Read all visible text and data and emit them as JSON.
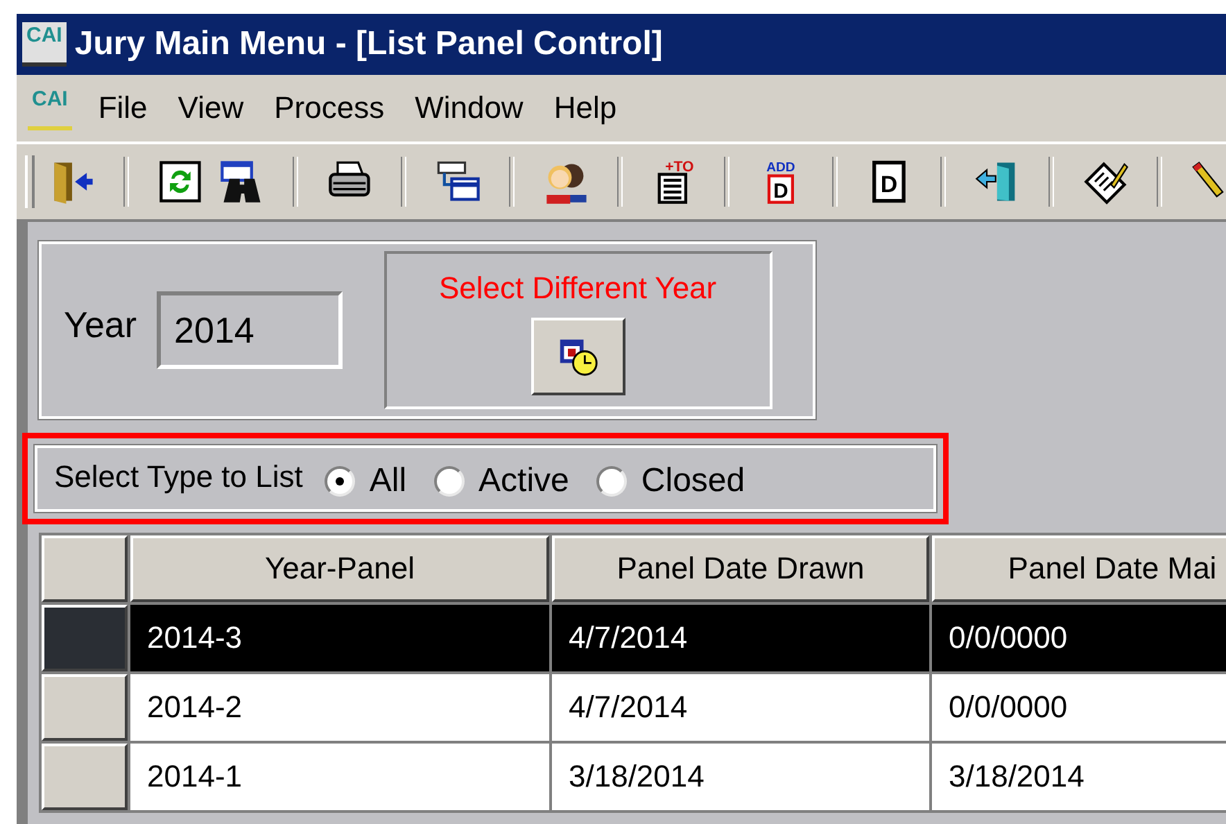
{
  "window": {
    "logo": "CAI",
    "title": "Jury Main Menu - [List Panel Control]"
  },
  "menu": {
    "logo": "CAI",
    "items": [
      "File",
      "View",
      "Process",
      "Window",
      "Help"
    ]
  },
  "toolbar": [
    [
      {
        "kind": "exit"
      }
    ],
    [
      {
        "kind": "refresh"
      },
      {
        "kind": "find"
      }
    ],
    [
      {
        "kind": "print"
      }
    ],
    [
      {
        "kind": "window"
      }
    ],
    [
      {
        "kind": "people"
      }
    ],
    [
      {
        "kind": "add-to",
        "tag": "+TO"
      }
    ],
    [
      {
        "kind": "add-d",
        "tag": "ADD",
        "text": "D"
      }
    ],
    [
      {
        "kind": "d",
        "text": "D"
      }
    ],
    [
      {
        "kind": "door"
      }
    ],
    [
      {
        "kind": "notes"
      }
    ],
    [
      {
        "kind": "pencil"
      }
    ]
  ],
  "year": {
    "label": "Year",
    "value": "2014",
    "select_caption": "Select Different Year"
  },
  "type_filter": {
    "label": "Select Type to List",
    "options": [
      {
        "label": "All",
        "selected": true
      },
      {
        "label": "Active",
        "selected": false
      },
      {
        "label": "Closed",
        "selected": false
      }
    ]
  },
  "table": {
    "columns": [
      "Year-Panel",
      "Panel Date Drawn",
      "Panel Date Mai"
    ],
    "rows": [
      {
        "cells": [
          "2014-3",
          "4/7/2014",
          "0/0/0000"
        ],
        "selected": true
      },
      {
        "cells": [
          "2014-2",
          "4/7/2014",
          "0/0/0000"
        ],
        "selected": false
      },
      {
        "cells": [
          "2014-1",
          "3/18/2014",
          "3/18/2014"
        ],
        "selected": false
      }
    ]
  }
}
